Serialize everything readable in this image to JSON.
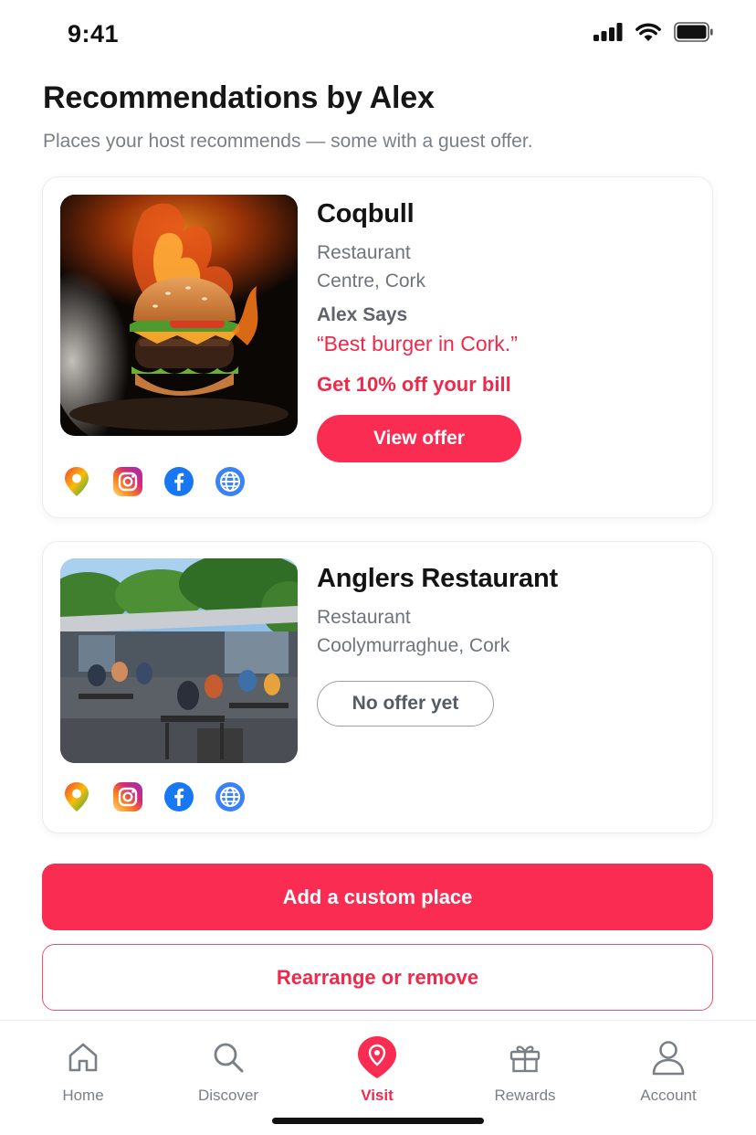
{
  "status_bar": {
    "time": "9:41",
    "icons": [
      "signal-icon",
      "wifi-icon",
      "battery-icon"
    ]
  },
  "header": {
    "title": "Recommendations by Alex",
    "subtitle": "Places your host recommends — some with a guest offer."
  },
  "places": [
    {
      "name": "Coqbull",
      "type": "Restaurant",
      "area": "Centre, Cork",
      "says_label": "Alex Says",
      "quote": "“Best burger in Cork.”",
      "offer": "Get 10% off your bill",
      "button_label": "View offer",
      "photo": "burger-photo",
      "links": [
        "map-pin-icon",
        "instagram-icon",
        "facebook-icon",
        "globe-icon"
      ]
    },
    {
      "name": "Anglers Restaurant",
      "type": "Restaurant",
      "area": "Coolymurraghue, Cork",
      "button_label": "No offer yet",
      "photo": "outdoor-terrace-photo",
      "links": [
        "map-pin-icon",
        "instagram-icon",
        "facebook-icon",
        "globe-icon"
      ]
    }
  ],
  "actions": {
    "add_label": "Add a custom place",
    "rearrange_label": "Rearrange or remove"
  },
  "tab_bar": {
    "tabs": [
      {
        "label": "Home",
        "icon": "home-icon"
      },
      {
        "label": "Discover",
        "icon": "search-icon"
      },
      {
        "label": "Visit",
        "icon": "location-pin-icon",
        "active": true
      },
      {
        "label": "Rewards",
        "icon": "gift-icon"
      },
      {
        "label": "Account",
        "icon": "user-icon"
      }
    ]
  },
  "colors": {
    "accent": "#fb2c52",
    "accent_text": "#f0284a",
    "muted_text": "#6f747c"
  }
}
